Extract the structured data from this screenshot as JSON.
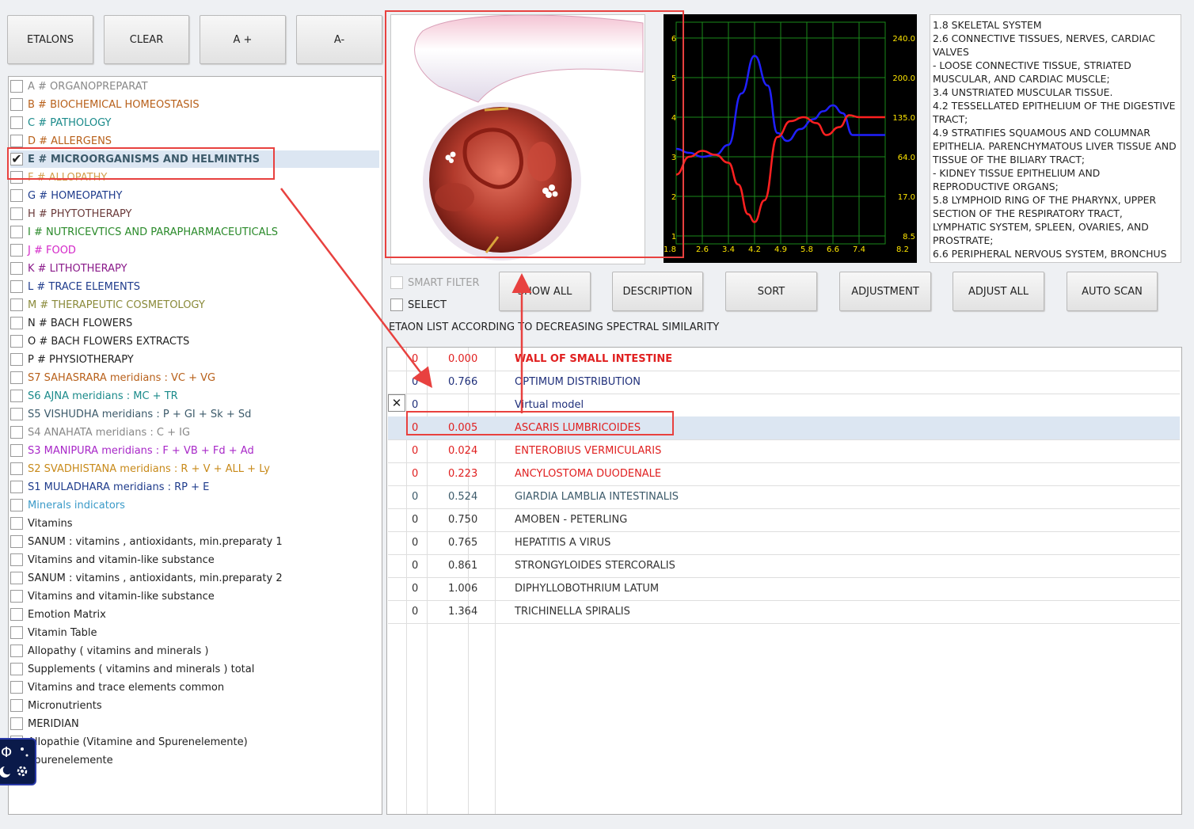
{
  "toolbar": {
    "etalons": "ETALONS",
    "clear": "CLEAR",
    "zoom_in": "A +",
    "zoom_out": "A-"
  },
  "categories": [
    {
      "label": "A # ORGANOPREPARAT",
      "color": "#888888",
      "checked": false,
      "bold": false
    },
    {
      "label": "B # BIOCHEMICAL HOMEOSTASIS",
      "color": "#b8601a",
      "checked": false,
      "bold": false
    },
    {
      "label": "C # PATHOLOGY",
      "color": "#1a8a8a",
      "checked": false,
      "bold": false
    },
    {
      "label": "D # ALLERGENS",
      "color": "#b8601a",
      "checked": false,
      "bold": false
    },
    {
      "label": "E # MICROORGANISMS AND HELMINTHS",
      "color": "#3c5a6a",
      "checked": true,
      "bold": true
    },
    {
      "label": "F # ALLOPATHY",
      "color": "#d4a050",
      "checked": false,
      "bold": false
    },
    {
      "label": "G # HOMEOPATHY",
      "color": "#1f3c8c",
      "checked": false,
      "bold": false
    },
    {
      "label": "H # PHYTOTHERAPY",
      "color": "#6a3a3a",
      "checked": false,
      "bold": false
    },
    {
      "label": "I # NUTRICEVTICS AND PARAPHARMACEUTICALS",
      "color": "#2a8a2a",
      "checked": false,
      "bold": false
    },
    {
      "label": "J # FOOD",
      "color": "#d428c8",
      "checked": false,
      "bold": false
    },
    {
      "label": "K # LITHOTHERAPY",
      "color": "#8a1a8a",
      "checked": false,
      "bold": false
    },
    {
      "label": "L # TRACE ELEMENTS",
      "color": "#1f3c8c",
      "checked": false,
      "bold": false
    },
    {
      "label": "M # THERAPEUTIC COSMETOLOGY",
      "color": "#8a8a3a",
      "checked": false,
      "bold": false
    },
    {
      "label": "N # BACH FLOWERS",
      "color": "#222222",
      "checked": false,
      "bold": false
    },
    {
      "label": "O # BACH FLOWERS EXTRACTS",
      "color": "#222222",
      "checked": false,
      "bold": false
    },
    {
      "label": "P # PHYSIOTHERAPY",
      "color": "#222222",
      "checked": false,
      "bold": false
    },
    {
      "label": "S7 SAHASRARA meridians : VC + VG",
      "color": "#b8601a",
      "checked": false,
      "bold": false
    },
    {
      "label": "S6 AJNA meridians : MC + TR",
      "color": "#1a8a8a",
      "checked": false,
      "bold": false
    },
    {
      "label": "S5 VISHUDHA meridians : P + GI + Sk + Sd",
      "color": "#3c5a6a",
      "checked": false,
      "bold": false
    },
    {
      "label": "S4 ANAHATA meridians : C + IG",
      "color": "#888888",
      "checked": false,
      "bold": false
    },
    {
      "label": "S3 MANIPURA meridians : F + VB + Fd + Ad",
      "color": "#a828c8",
      "checked": false,
      "bold": false
    },
    {
      "label": "S2 SVADHISTANA meridians : R + V + ALL + Ly",
      "color": "#c88a1a",
      "checked": false,
      "bold": false
    },
    {
      "label": "S1 MULADHARA meridians : RP + E",
      "color": "#1f3c8c",
      "checked": false,
      "bold": false
    },
    {
      "label": "Minerals indicators",
      "color": "#3a9ac8",
      "checked": false,
      "bold": false
    },
    {
      "label": "Vitamins",
      "color": "#222222",
      "checked": false,
      "bold": false
    },
    {
      "label": "SANUM : vitamins , antioxidants, min.preparaty 1",
      "color": "#222222",
      "checked": false,
      "bold": false
    },
    {
      "label": "Vitamins and vitamin-like substance",
      "color": "#222222",
      "checked": false,
      "bold": false
    },
    {
      "label": "SANUM : vitamins , antioxidants, min.preparaty 2",
      "color": "#222222",
      "checked": false,
      "bold": false
    },
    {
      "label": "Vitamins and vitamin-like substance",
      "color": "#222222",
      "checked": false,
      "bold": false
    },
    {
      "label": "Emotion Matrix",
      "color": "#222222",
      "checked": false,
      "bold": false
    },
    {
      "label": "Vitamin Table",
      "color": "#222222",
      "checked": false,
      "bold": false
    },
    {
      "label": "Allopathy ( vitamins and minerals )",
      "color": "#222222",
      "checked": false,
      "bold": false
    },
    {
      "label": "Supplements ( vitamins and minerals ) total",
      "color": "#222222",
      "checked": false,
      "bold": false
    },
    {
      "label": "Vitamins and trace elements common",
      "color": "#222222",
      "checked": false,
      "bold": false
    },
    {
      "label": "Micronutrients",
      "color": "#222222",
      "checked": false,
      "bold": false
    },
    {
      "label": "MERIDIAN",
      "color": "#222222",
      "checked": false,
      "bold": false
    },
    {
      "label": "Allopathie (Vitamine and Spurenelemente)",
      "color": "#222222",
      "checked": false,
      "bold": false
    },
    {
      "label": "Spurenelemente",
      "color": "#222222",
      "checked": false,
      "bold": false
    }
  ],
  "chart_data": {
    "type": "line",
    "x_ticks": [
      "1.8",
      "2.6",
      "3.4",
      "4.2",
      "4.9",
      "5.8",
      "6.6",
      "7.4",
      "8.2"
    ],
    "y_left_ticks": [
      "6",
      "5",
      "4",
      "3",
      "2",
      "1"
    ],
    "y_right_ticks": [
      "240.0",
      "200.0",
      "135.0",
      "64.0",
      "17.0",
      "8.5"
    ],
    "ylim": [
      0.8,
      6.4
    ],
    "xlim": [
      1.8,
      8.2
    ],
    "grid": true,
    "series": [
      {
        "color": "#2020ff",
        "x": [
          1.8,
          2.2,
          2.6,
          3.0,
          3.4,
          3.8,
          4.2,
          4.6,
          4.9,
          5.2,
          5.6,
          6.0,
          6.3,
          6.6,
          6.9,
          7.2,
          7.4,
          8.2
        ],
        "y": [
          3.2,
          3.1,
          3.0,
          3.05,
          3.3,
          4.6,
          5.55,
          4.8,
          3.6,
          3.4,
          3.7,
          3.95,
          4.15,
          4.3,
          4.1,
          3.55,
          3.55,
          3.55
        ]
      },
      {
        "color": "#ff2020",
        "x": [
          1.8,
          2.2,
          2.6,
          3.0,
          3.4,
          3.7,
          4.0,
          4.2,
          4.5,
          4.9,
          5.3,
          5.7,
          6.1,
          6.4,
          6.8,
          7.1,
          7.4,
          8.2
        ],
        "y": [
          2.55,
          3.0,
          3.15,
          3.05,
          2.85,
          2.3,
          1.55,
          1.35,
          1.9,
          3.5,
          3.9,
          4.0,
          3.85,
          3.55,
          3.75,
          4.05,
          4.0,
          4.0
        ]
      }
    ]
  },
  "description": {
    "lines": [
      "1.8 SKELETAL SYSTEM",
      "2.6 CONNECTIVE TISSUES, NERVES, CARDIAC VALVES",
      "- LOOSE CONNECTIVE TISSUE, STRIATED MUSCULAR, AND CARDIAC MUSCLE;",
      "3.4 UNSTRIATED MUSCULAR TISSUE.",
      "4.2 TESSELLATED EPITHELIUM OF THE DIGESTIVE TRACT;",
      "4.9 STRATIFIES SQUAMOUS AND COLUMNAR EPITHELIA. PARENCHYMATOUS LIVER TISSUE AND TISSUE OF THE BILIARY TRACT;",
      "- KIDNEY TISSUE EPITHELIUM AND REPRODUCTIVE ORGANS;",
      "5.8 LYMPHOID RING OF THE PHARYNX, UPPER SECTION OF THE RESPIRATORY TRACT, LYMPHATIC SYSTEM, SPLEEN, OVARIES, AND PROSTRATE;",
      "6.6 PERIPHERAL NERVOUS SYSTEM, BRONCHUS"
    ]
  },
  "filters": {
    "smart_filter": "SMART FILTER",
    "select": "SELECT"
  },
  "actions": {
    "show_all": "SHOW ALL",
    "description": "DESCRIPTION",
    "sort": "SORT",
    "adjustment": "ADJUSTMENT",
    "adjust_all": "ADJUST ALL",
    "auto_scan": "AUTO SCAN"
  },
  "list_title": "ETAON LIST ACCORDING TO DECREASING SPECTRAL SIMILARITY",
  "rows": [
    {
      "num": "0",
      "value": "0.000",
      "name": "WALL OF SMALL  INTESTINE",
      "num_color": "#e02020",
      "val_color": "#e02020",
      "name_color": "#e02020",
      "bold": true,
      "selected": false
    },
    {
      "num": "0",
      "value": "0.766",
      "name": "OPTIMUM DISTRIBUTION",
      "num_color": "#1f2f7a",
      "val_color": "#1f2f7a",
      "name_color": "#1f2f7a",
      "bold": false,
      "selected": false
    },
    {
      "num": "0",
      "value": "",
      "name": "Virtual model",
      "num_color": "#1f2f7a",
      "val_color": "#1f2f7a",
      "name_color": "#1f2f7a",
      "bold": false,
      "selected": false
    },
    {
      "num": "0",
      "value": "0.005",
      "name": "ASCARIS  LUMBRICOIDES",
      "num_color": "#e02020",
      "val_color": "#e02020",
      "name_color": "#e02020",
      "bold": false,
      "selected": true
    },
    {
      "num": "0",
      "value": "0.024",
      "name": "ENTEROBIUS  VERMICULARIS",
      "num_color": "#e02020",
      "val_color": "#e02020",
      "name_color": "#e02020",
      "bold": false,
      "selected": false
    },
    {
      "num": "0",
      "value": "0.223",
      "name": "ANCYLOSTOMA DUODENALE",
      "num_color": "#e02020",
      "val_color": "#e02020",
      "name_color": "#e02020",
      "bold": false,
      "selected": false
    },
    {
      "num": "0",
      "value": "0.524",
      "name": "GIARDIA LAMBLIA INTESTINALIS",
      "num_color": "#3c5a6a",
      "val_color": "#3c5a6a",
      "name_color": "#3c5a6a",
      "bold": false,
      "selected": false
    },
    {
      "num": "0",
      "value": "0.750",
      "name": "AMOBEN  -  PETERLING",
      "num_color": "#333333",
      "val_color": "#333333",
      "name_color": "#333333",
      "bold": false,
      "selected": false
    },
    {
      "num": "0",
      "value": "0.765",
      "name": "HEPATITIS A VIRUS",
      "num_color": "#333333",
      "val_color": "#333333",
      "name_color": "#333333",
      "bold": false,
      "selected": false
    },
    {
      "num": "0",
      "value": "0.861",
      "name": "STRONGYLOIDES  STERCORALIS",
      "num_color": "#333333",
      "val_color": "#333333",
      "name_color": "#333333",
      "bold": false,
      "selected": false
    },
    {
      "num": "0",
      "value": "1.006",
      "name": "DIPHYLLOBOTHRIUM LATUM",
      "num_color": "#333333",
      "val_color": "#333333",
      "name_color": "#333333",
      "bold": false,
      "selected": false
    },
    {
      "num": "0",
      "value": "1.364",
      "name": "TRICHINELLA  SPIRALIS",
      "num_color": "#333333",
      "val_color": "#333333",
      "name_color": "#333333",
      "bold": false,
      "selected": false
    }
  ],
  "close_glyph": "✕",
  "check_glyph": "✔",
  "icons": {
    "close": "close-icon",
    "arrow": "annotation-arrow",
    "floating": "floating-widget-icon"
  },
  "colors": {
    "highlight": "#e8413f",
    "selection": "#dce6f2"
  }
}
